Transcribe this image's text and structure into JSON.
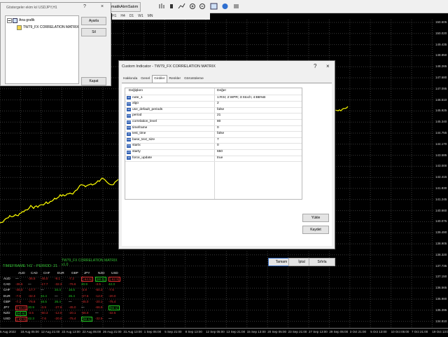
{
  "toolbar": {
    "algo_trading_label": "OtomatikAlımSatım",
    "timeframes": [
      "H1",
      "H4",
      "D1",
      "W1",
      "MN"
    ]
  },
  "indicators_window": {
    "title": "Göstergeler ekim kıl USDJPY,H1",
    "tree_root": "Ana grafik",
    "tree_child": "TW79_FX CORRELATION MATRIX",
    "edit_button": "Ayarla",
    "delete_button": "Sil",
    "close_button": "Kapat"
  },
  "dialog": {
    "title": "Custom Indicator - TW79_FX CORRELATION MATRIX",
    "help_glyph": "?",
    "close_glyph": "×",
    "tabs": [
      "Hakkında",
      "Genel",
      "Girdiler",
      "Renkler",
      "Görüntüleme"
    ],
    "active_tab": 2,
    "col_variable": "Değişken",
    "col_value": "Değer",
    "inputs": [
      {
        "name": "note_1",
        "value": "1:RSI; 2:WPR; 3:Stoch; 4:BB%B",
        "icon": "ab"
      },
      {
        "name": "algo",
        "value": "2",
        "icon": "123"
      },
      {
        "name": "use_default_periods",
        "value": "false",
        "icon": "ab"
      },
      {
        "name": "period",
        "value": "21",
        "icon": "123"
      },
      {
        "name": "correlation_level",
        "value": "80",
        "icon": "123"
      },
      {
        "name": "timeframe",
        "value": "0",
        "icon": "123"
      },
      {
        "name": "test_time",
        "value": "false",
        "icon": "ab"
      },
      {
        "name": "base_text_size",
        "value": "7",
        "icon": "123"
      },
      {
        "name": "startx",
        "value": "0",
        "icon": "123"
      },
      {
        "name": "starty",
        "value": "650",
        "icon": "123"
      },
      {
        "name": "force_update",
        "value": "true",
        "icon": "ab"
      }
    ],
    "load_button": "Yükle",
    "save_button": "Kaydet",
    "ok_button": "Tamam",
    "cancel_button": "İptal",
    "reset_button": "Sıfırla"
  },
  "correlation_panel": {
    "title": "TW79_FX CORRELATION MATRIX v1.0",
    "timeframe_label": "TIMEFRAME 'H1' - PERIOD: 21",
    "columns": [
      "AUD",
      "CAD",
      "CHF",
      "EUR",
      "GBP",
      "JPY",
      "NZD",
      "USD"
    ],
    "rows": [
      {
        "label": "AUD",
        "cells": [
          "—",
          "-36.5",
          "-45.0",
          "-9.1",
          "-7.2",
          "[-64.5]",
          "[80.5]",
          "[-62.9]"
        ]
      },
      {
        "label": "CAD",
        "cells": [
          "-36.5",
          "—",
          "-17.7",
          "-32.3",
          "-76.6",
          "20.9",
          "-3.5",
          "42.3"
        ]
      },
      {
        "label": "CHF",
        "cells": [
          "-45.0",
          "-17.7",
          "—",
          "34.4",
          "16.5",
          "-3.9",
          "-60.3",
          "-7.6"
        ]
      },
      {
        "label": "EUR",
        "cells": [
          "-7.6",
          "-32.3",
          "34.4",
          "—",
          "26.4",
          "-27.6",
          "-12.0",
          "-20.0"
        ]
      },
      {
        "label": "GBP",
        "cells": [
          "-7.2",
          "-76.6",
          "16.5",
          "26.4",
          "—",
          "-45.0",
          "-20.1",
          "-75.4"
        ]
      },
      {
        "label": "JPY",
        "cells": [
          "[-64.0]",
          "20.9",
          "-3.9",
          "-27.6",
          "-45.0",
          "—",
          "-66.9",
          "[92.1]"
        ]
      },
      {
        "label": "NZD",
        "cells": [
          "[80.5]",
          "-3.5",
          "-60.3",
          "-12.0",
          "-20.1",
          "-66.9",
          "—",
          "-32.5"
        ]
      },
      {
        "label": "USD",
        "cells": [
          "[-62.9]",
          "42.3",
          "-7.6",
          "-20.0",
          "-75.4",
          "[92.1]",
          "-32.5",
          "—"
        ]
      }
    ]
  },
  "price_axis": [
    "150.605",
    "150.020",
    "149.435",
    "148.850",
    "148.265",
    "147.680",
    "147.095",
    "146.510",
    "145.925",
    "145.340",
    "144.755",
    "144.170",
    "143.585",
    "143.000",
    "142.415",
    "141.830",
    "141.245",
    "140.660",
    "140.075",
    "139.490",
    "138.905",
    "138.320",
    "137.735",
    "137.150",
    "136.565",
    "135.980",
    "135.395",
    "134.810"
  ],
  "time_axis": [
    "5 Aug 2022",
    "18 Aug 05:00",
    "12 Aug 21:00",
    "22 Aug 13:00",
    "22 Aug 05:00",
    "26 Aug 21:00",
    "31 Aug 13:00",
    "1 Sep 05:00",
    "5 Sep 21:00",
    "8 Sep 13:00",
    "12 Sep 05:00",
    "13 Sep 21:00",
    "15 Sep 13:00",
    "20 Sep 05:00",
    "23 Sep 21:00",
    "27 Sep 13:00",
    "29 Sep 05:00",
    "3 Oct 21:00",
    "5 Oct 13:00",
    "10 Oct 05:00",
    "7 Oct 21:00",
    "19 Oct 13:00"
  ],
  "colors": {
    "chart_bg": "#000000",
    "candles": "#ffff00",
    "grid": "#ffffff",
    "positive": "#22c922",
    "negative": "#e03030"
  }
}
